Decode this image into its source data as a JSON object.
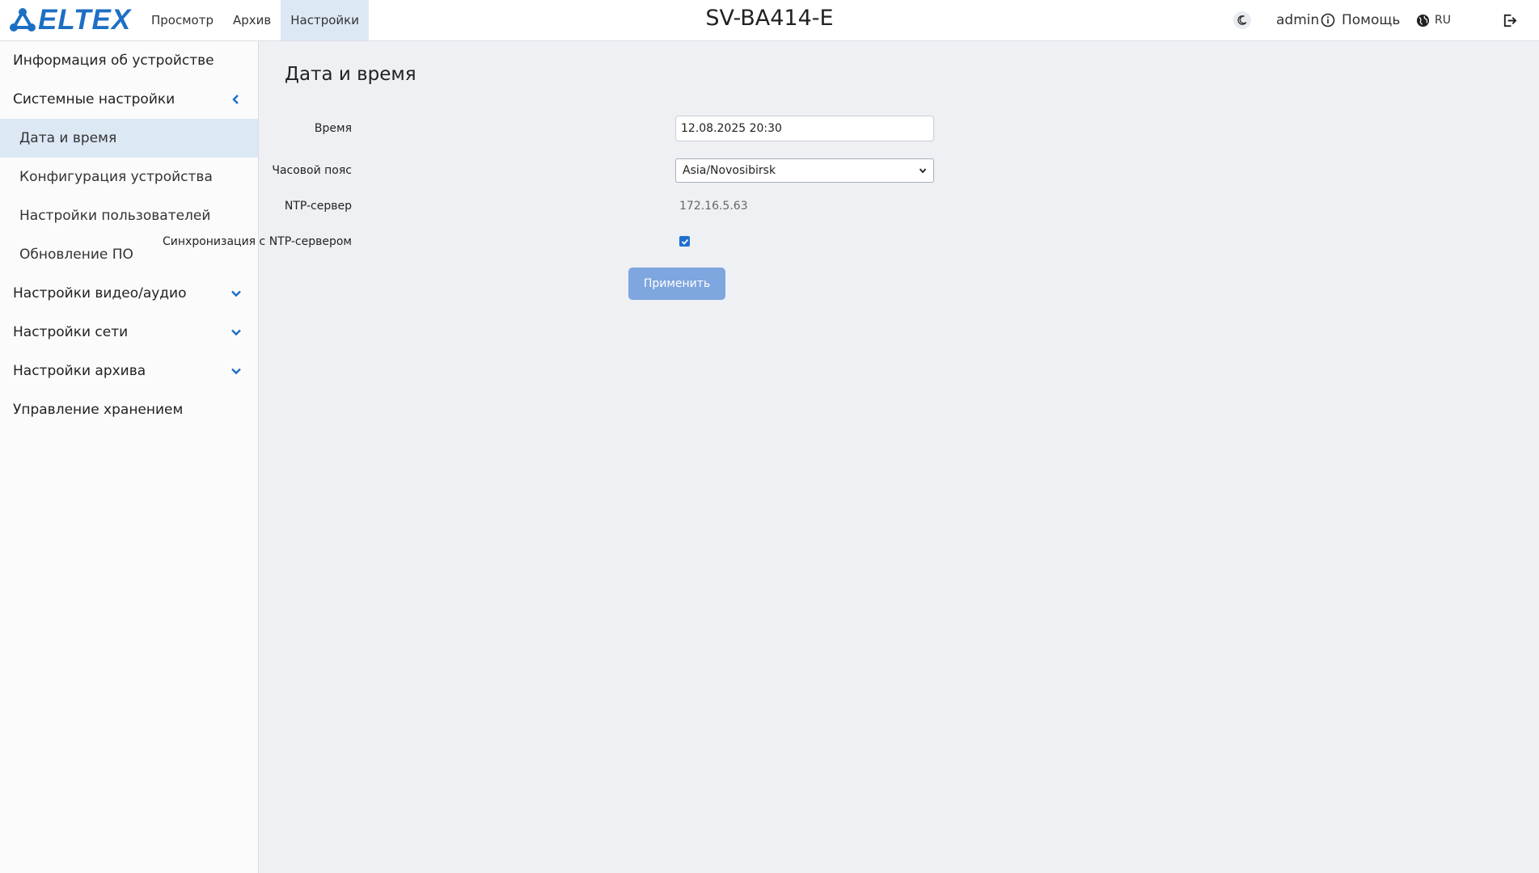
{
  "header": {
    "logo_text": "ELTEX",
    "nav": [
      {
        "label": "Просмотр"
      },
      {
        "label": "Архив"
      },
      {
        "label": "Настройки"
      }
    ],
    "device_name": "SV-BA414-E",
    "user": "admin",
    "help_label": "Помощь",
    "language": "RU"
  },
  "sidebar": {
    "items": [
      {
        "label": "Информация об устройстве"
      },
      {
        "label": "Системные настройки"
      },
      {
        "label": "Дата и время"
      },
      {
        "label": "Конфигурация устройства"
      },
      {
        "label": "Настройки пользователей"
      },
      {
        "label": "Обновление ПО"
      },
      {
        "label": "Настройки видео/аудио"
      },
      {
        "label": "Настройки сети"
      },
      {
        "label": "Настройки архива"
      },
      {
        "label": "Управление хранением"
      }
    ]
  },
  "main": {
    "title": "Дата и время",
    "time": {
      "label": "Время",
      "value": "12.08.2025 20:30"
    },
    "timezone": {
      "label": "Часовой пояс",
      "value": "Asia/Novosibirsk"
    },
    "ntp_server": {
      "label": "NTP-сервер",
      "value": "172.16.5.63"
    },
    "ntp_sync": {
      "label": "Синхронизация с NTP-сервером",
      "checked": true
    },
    "apply_label": "Применить"
  },
  "colors": {
    "accent": "#1d6fc4",
    "active_bg": "#dde8f5",
    "button_disabled": "#7ea6df",
    "page_bg": "#eef0f4"
  },
  "icons": [
    "eltex-logo-icon",
    "moon-icon",
    "info-icon",
    "globe-icon",
    "logout-icon",
    "chevron-left-icon",
    "chevron-down-icon",
    "check-icon",
    "select-arrow-icon"
  ]
}
